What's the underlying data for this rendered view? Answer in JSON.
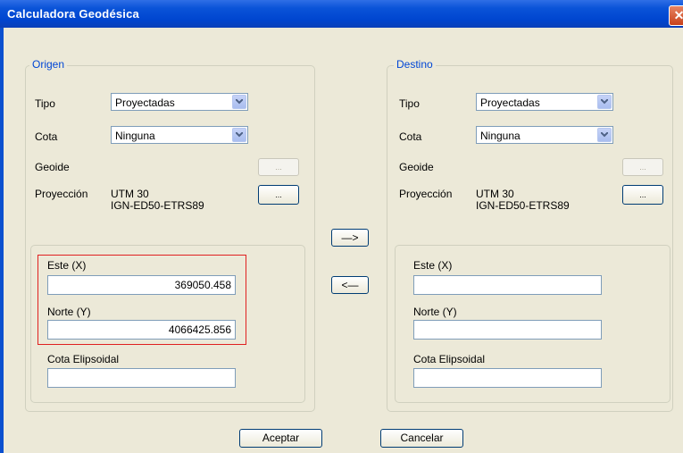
{
  "window": {
    "title": "Calculadora Geodésica"
  },
  "origin": {
    "legend": "Origen",
    "tipo_label": "Tipo",
    "tipo_value": "Proyectadas",
    "cota_label": "Cota",
    "cota_value": "Ninguna",
    "geoide_label": "Geoide",
    "geoide_button": "...",
    "proyeccion_label": "Proyección",
    "proyeccion_line1": "UTM 30",
    "proyeccion_line2": "IGN-ED50-ETRS89",
    "proyeccion_button": "...",
    "este_label": "Este (X)",
    "este_value": "369050.458",
    "norte_label": "Norte (Y)",
    "norte_value": "4066425.856",
    "cota_elip_label": "Cota Elipsoidal",
    "cota_elip_value": ""
  },
  "destination": {
    "legend": "Destino",
    "tipo_label": "Tipo",
    "tipo_value": "Proyectadas",
    "cota_label": "Cota",
    "cota_value": "Ninguna",
    "geoide_label": "Geoide",
    "geoide_button": "...",
    "proyeccion_label": "Proyección",
    "proyeccion_line1": "UTM 30",
    "proyeccion_line2": "IGN-ED50-ETRS89",
    "proyeccion_button": "...",
    "este_label": "Este (X)",
    "este_value": "",
    "norte_label": "Norte (Y)",
    "norte_value": "",
    "cota_elip_label": "Cota Elipsoidal",
    "cota_elip_value": ""
  },
  "transfer": {
    "forward": "—>",
    "backward": "<—"
  },
  "footer": {
    "accept": "Aceptar",
    "cancel": "Cancelar"
  },
  "colors": {
    "title_blue": "#0a53d8",
    "legend_blue": "#0046d5",
    "highlight_red": "#e02020",
    "dialog_bg": "#ece9d8"
  }
}
